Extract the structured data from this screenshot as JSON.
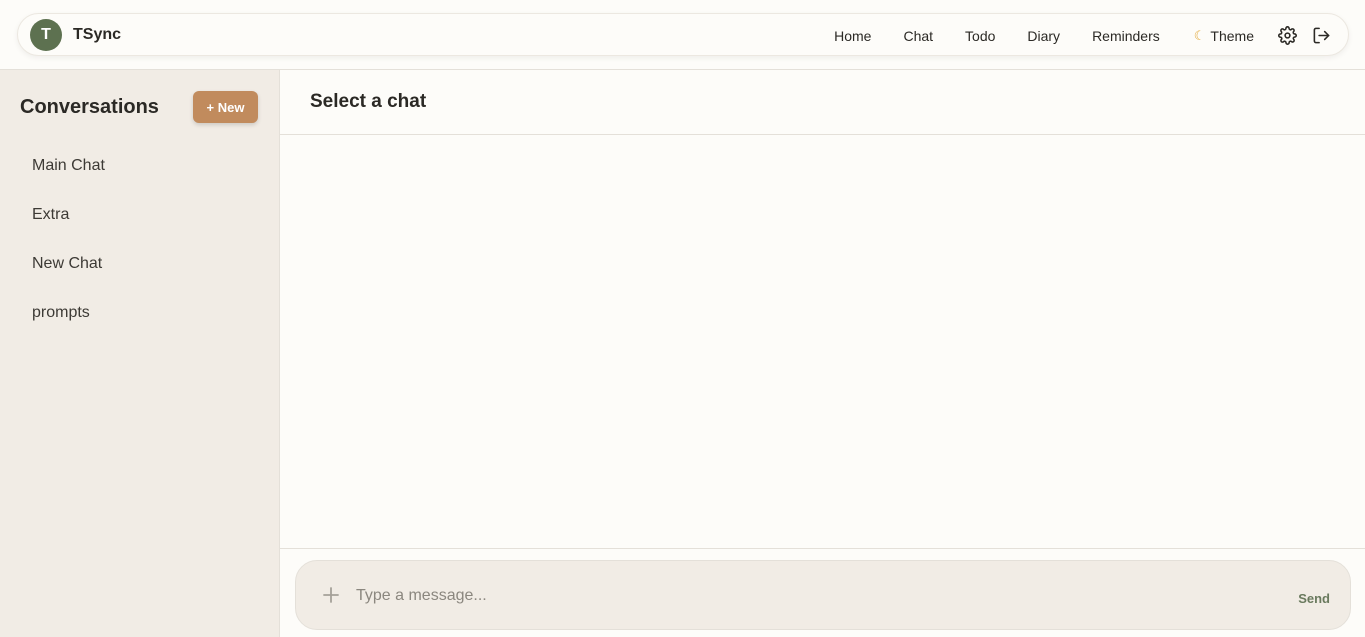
{
  "app": {
    "avatar_letter": "T",
    "name": "TSync"
  },
  "nav": {
    "links": [
      "Home",
      "Chat",
      "Todo",
      "Diary",
      "Reminders"
    ],
    "theme_label": "Theme",
    "theme_icon": "moon-icon",
    "settings_icon": "gear-icon",
    "logout_icon": "logout-icon"
  },
  "sidebar": {
    "title": "Conversations",
    "new_button": "+ New",
    "conversations": [
      "Main Chat",
      "Extra",
      "New Chat",
      "prompts"
    ]
  },
  "chat": {
    "title": "Select a chat"
  },
  "composer": {
    "attach_icon": "plus-icon",
    "placeholder": "Type a message...",
    "value": "",
    "send_label": "Send"
  },
  "colors": {
    "accent": "#c18b5d",
    "avatar": "#5d7150",
    "send": "#6a7a5e",
    "sidebar_bg": "#f1ece5",
    "page_bg": "#fdfcf9"
  }
}
